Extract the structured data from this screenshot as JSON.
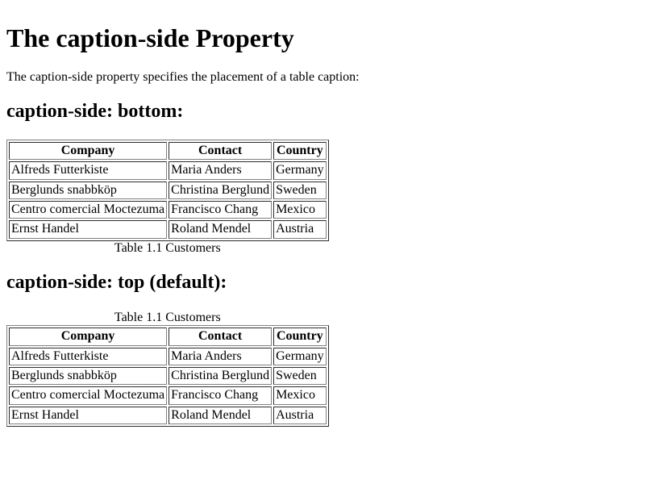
{
  "page": {
    "title": "The caption-side Property",
    "intro": "The caption-side property specifies the placement of a table caption:"
  },
  "sections": [
    {
      "heading": "caption-side: bottom:",
      "caption_side": "bottom",
      "table": {
        "caption": "Table 1.1 Customers",
        "headers": [
          "Company",
          "Contact",
          "Country"
        ],
        "rows": [
          [
            "Alfreds Futterkiste",
            "Maria Anders",
            "Germany"
          ],
          [
            "Berglunds snabbköp",
            "Christina Berglund",
            "Sweden"
          ],
          [
            "Centro comercial Moctezuma",
            "Francisco Chang",
            "Mexico"
          ],
          [
            "Ernst Handel",
            "Roland Mendel",
            "Austria"
          ]
        ]
      }
    },
    {
      "heading": "caption-side: top (default):",
      "caption_side": "top",
      "table": {
        "caption": "Table 1.1 Customers",
        "headers": [
          "Company",
          "Contact",
          "Country"
        ],
        "rows": [
          [
            "Alfreds Futterkiste",
            "Maria Anders",
            "Germany"
          ],
          [
            "Berglunds snabbköp",
            "Christina Berglund",
            "Sweden"
          ],
          [
            "Centro comercial Moctezuma",
            "Francisco Chang",
            "Mexico"
          ],
          [
            "Ernst Handel",
            "Roland Mendel",
            "Austria"
          ]
        ]
      }
    }
  ],
  "colors": {
    "background": "#ffffff",
    "text": "#000000",
    "table_border": "#808080"
  }
}
